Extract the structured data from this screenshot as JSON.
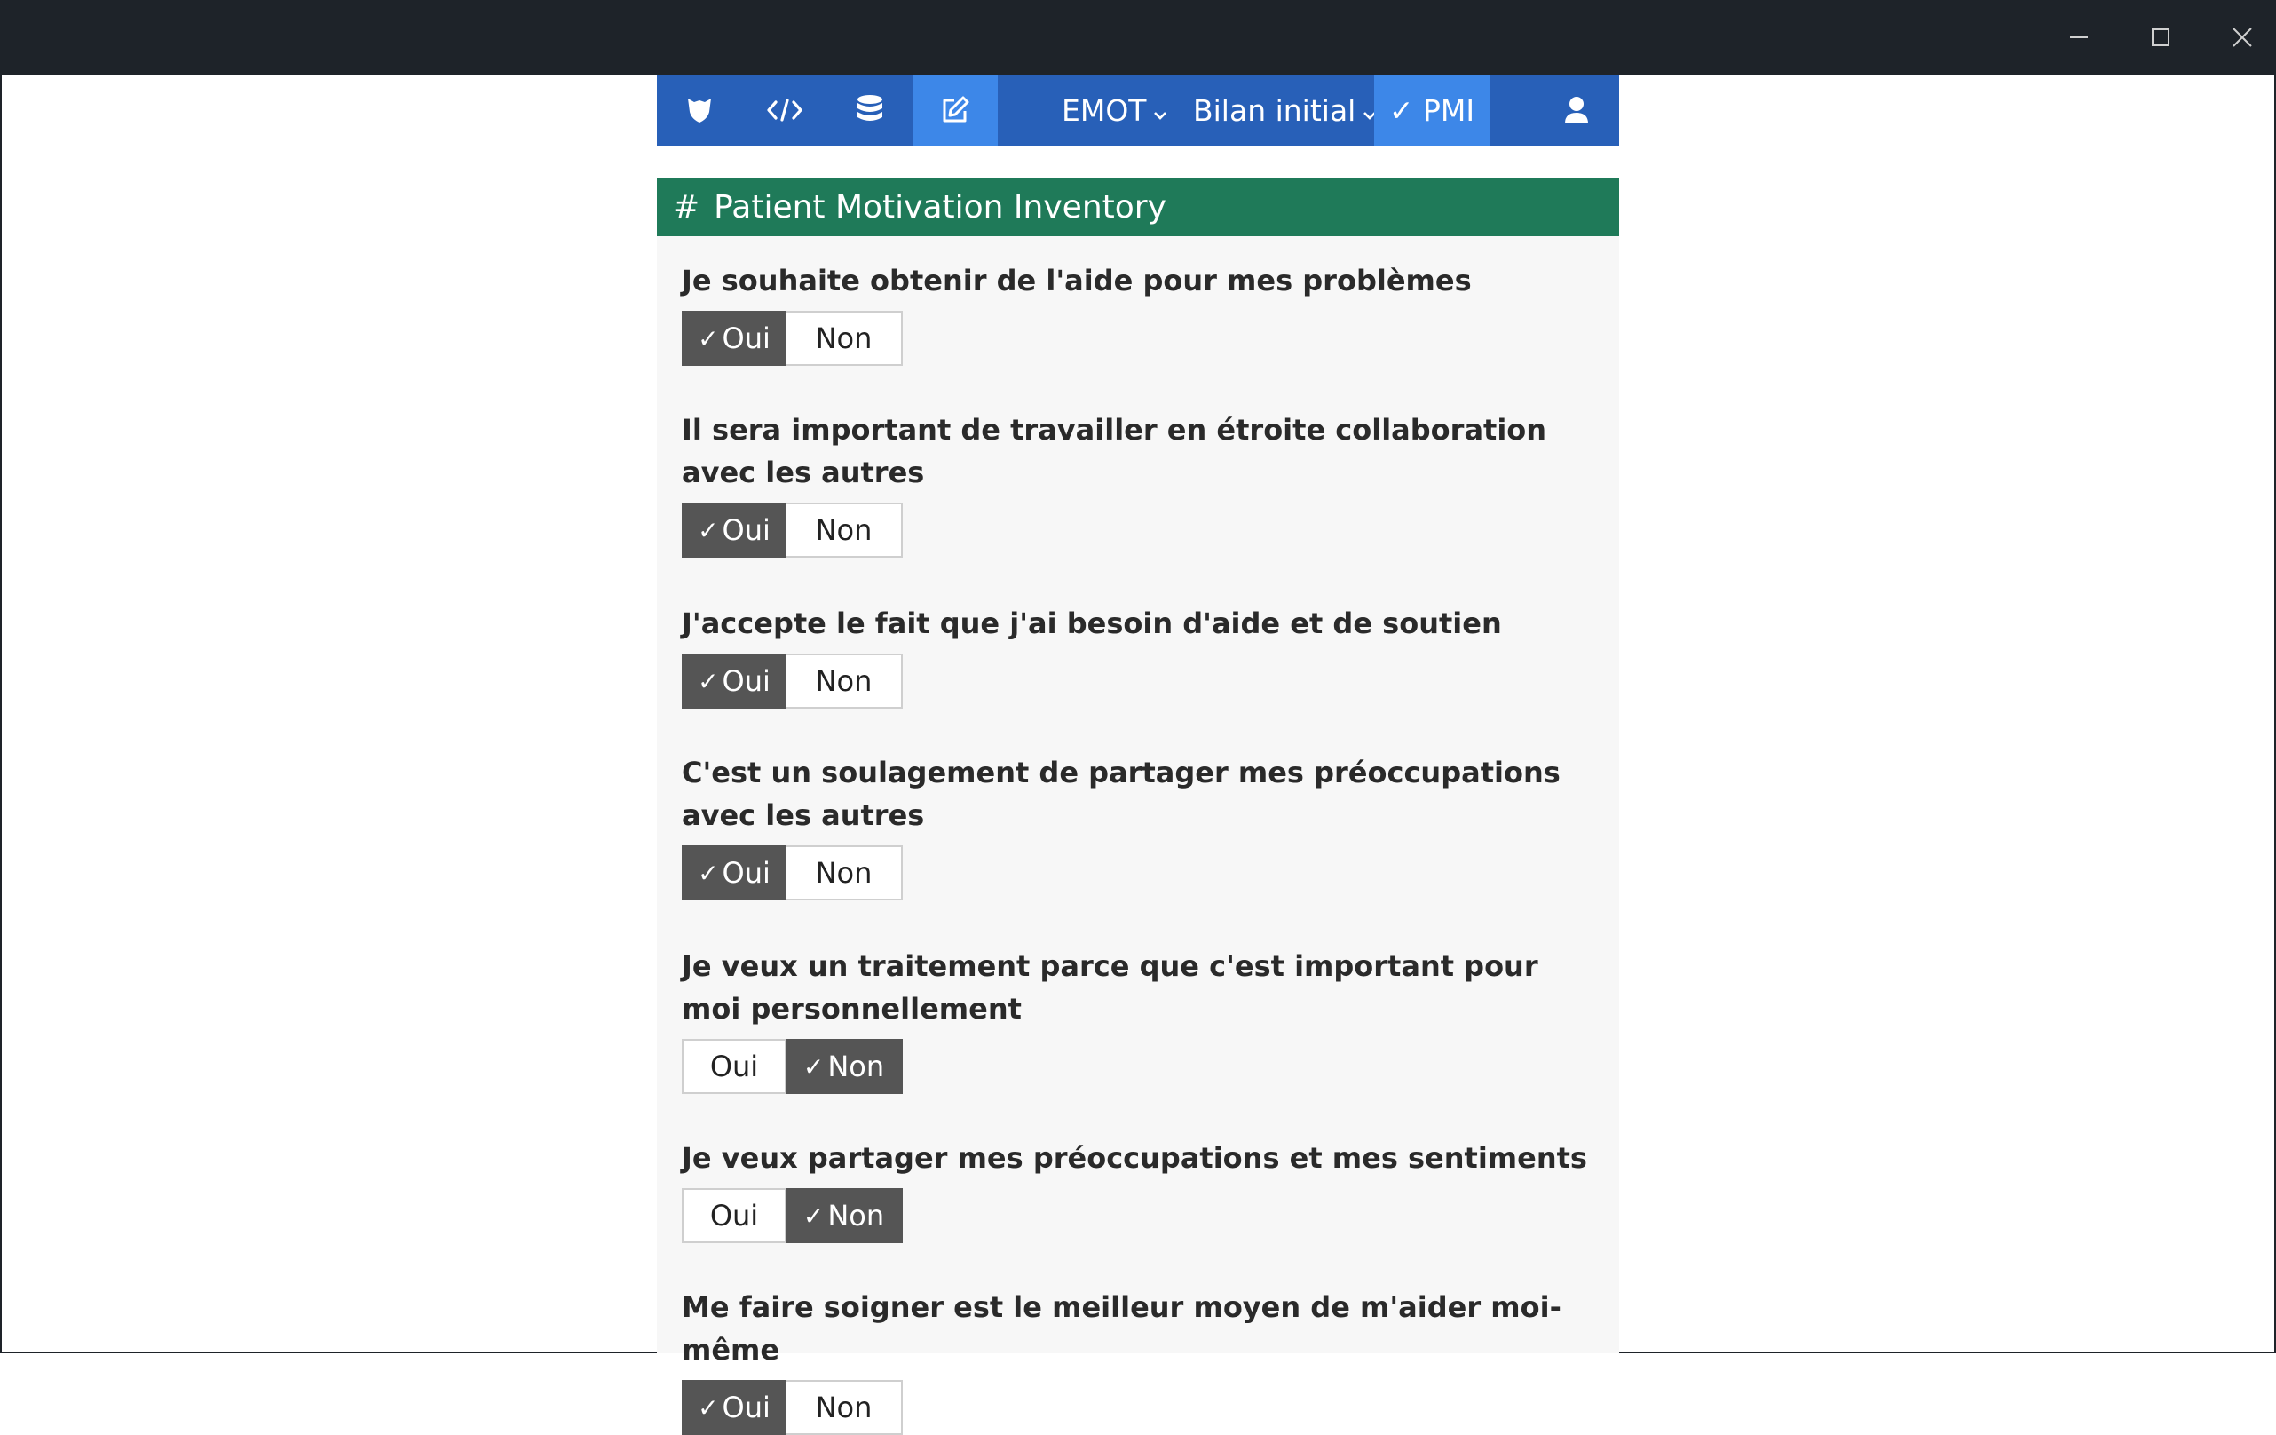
{
  "navbar": {
    "icons": [
      "shield-icon",
      "code-icon",
      "database-icon",
      "edit-icon",
      "user-icon"
    ],
    "emot_label": "EMOT",
    "bilan_label": "Bilan initial",
    "pmi_label": "✓ PMI"
  },
  "panel": {
    "hash": "#",
    "title": "Patient Motivation Inventory"
  },
  "check_mark": "✓",
  "questions": [
    {
      "label": "Je souhaite obtenir de l'aide pour mes problèmes",
      "oui": "Oui",
      "non": "Non",
      "selected": "Oui"
    },
    {
      "label": "Il sera important de travailler en étroite collaboration avec les autres",
      "oui": "Oui",
      "non": "Non",
      "selected": "Oui"
    },
    {
      "label": "J'accepte le fait que j'ai besoin d'aide et de soutien",
      "oui": "Oui",
      "non": "Non",
      "selected": "Oui"
    },
    {
      "label": "C'est un soulagement de partager mes préoccupations avec les autres",
      "oui": "Oui",
      "non": "Non",
      "selected": "Oui"
    },
    {
      "label": "Je veux un traitement parce que c'est important pour moi personnellement",
      "oui": "Oui",
      "non": "Non",
      "selected": "Non"
    },
    {
      "label": "Je veux partager mes préoccupations et mes sentiments",
      "oui": "Oui",
      "non": "Non",
      "selected": "Non"
    },
    {
      "label": "Me faire soigner est le meilleur moyen de m'aider moi-même",
      "oui": "Oui",
      "non": "Non",
      "selected": "Oui"
    }
  ],
  "colors": {
    "titlebar": "#1e2329",
    "navbar": "#2860b8",
    "navbar_active": "#3d87e8",
    "panel_header": "#1f7a59",
    "selected_button": "#555555"
  }
}
